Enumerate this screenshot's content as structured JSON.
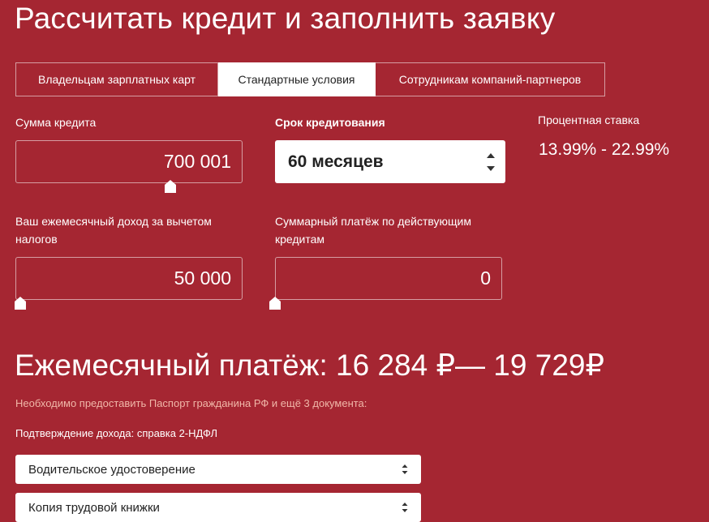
{
  "page": {
    "title": "Рассчитать кредит и заполнить заявку"
  },
  "tabs": [
    {
      "label": "Владельцам зарплатных карт",
      "active": false
    },
    {
      "label": "Стандартные условия",
      "active": true
    },
    {
      "label": "Сотрудникам компаний-партнеров",
      "active": false
    }
  ],
  "loan_amount": {
    "label": "Сумма кредита",
    "value": "700 001"
  },
  "term": {
    "label": "Срок кредитования",
    "value": "60 месяцев"
  },
  "rate": {
    "label": "Процентная ставка",
    "value": "13.99% - 22.99%"
  },
  "income": {
    "label": "Ваш ежемесячный доход за вычетом налогов",
    "value": "50 000"
  },
  "existing_payments": {
    "label": "Суммарный платёж по действующим кредитам",
    "value": "0"
  },
  "monthly_payment": {
    "text": "Ежемесячный платёж: 16 284 ₽— 19 729₽"
  },
  "documents": {
    "notice": "Необходимо предоставить Паспорт гражданина РФ и ещё 3 документа:",
    "income_proof": "Подтверждение дохода: справка 2-НДФЛ",
    "selects": [
      {
        "value": "Водительское удостоверение"
      },
      {
        "value": "Копия трудовой книжки"
      }
    ]
  },
  "colors": {
    "background": "#a52632",
    "notice_text": "#f0b7a8"
  }
}
